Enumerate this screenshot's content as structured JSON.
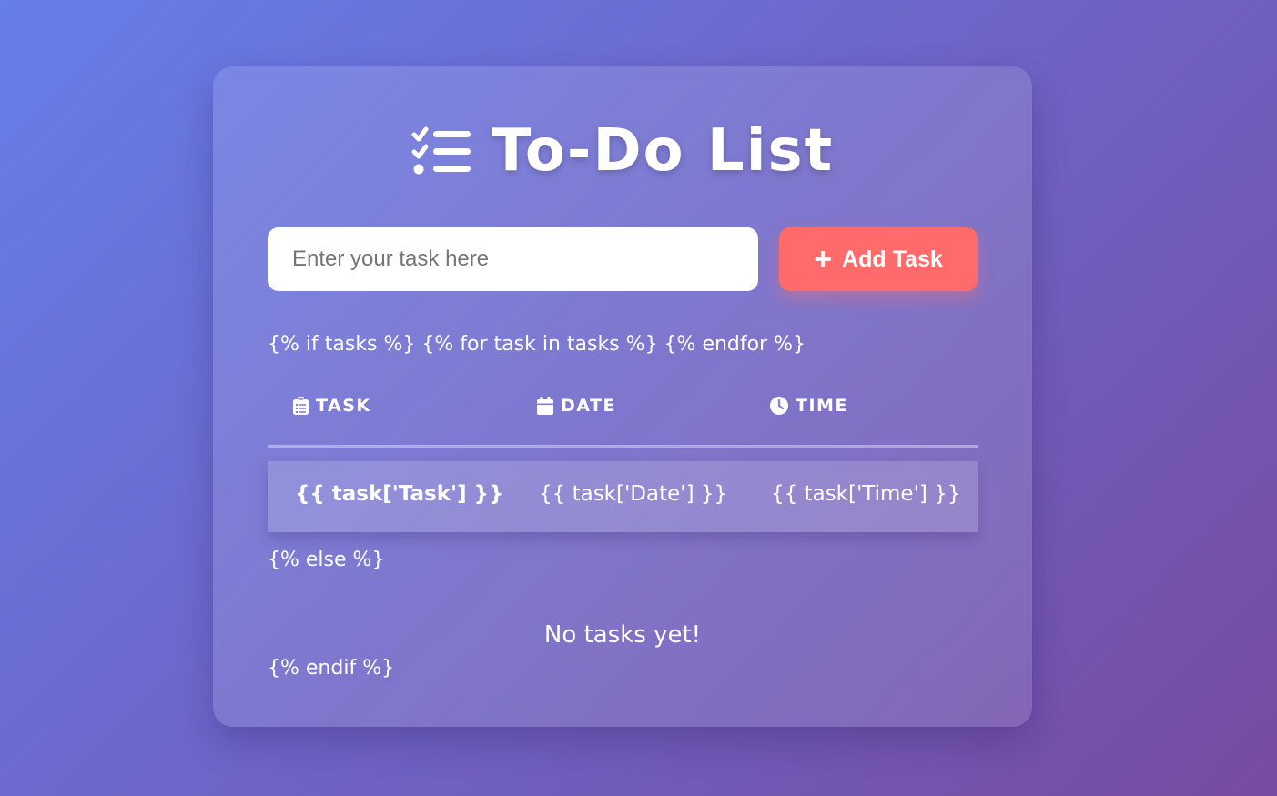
{
  "header": {
    "title": "To-Do List",
    "icon": "tasks-checklist-icon"
  },
  "form": {
    "input_placeholder": "Enter your task here",
    "input_value": "",
    "add_label": "Add Task",
    "add_icon": "plus-icon"
  },
  "template": {
    "if_line": "{% if tasks %} {% for task in tasks %} {% endfor %}",
    "else_line": "{% else %}",
    "endif_line": "{% endif %}"
  },
  "table": {
    "columns": [
      {
        "label": "TASK",
        "icon": "clipboard-list-icon"
      },
      {
        "label": "DATE",
        "icon": "calendar-icon"
      },
      {
        "label": "TIME",
        "icon": "clock-icon"
      }
    ],
    "rows": [
      {
        "task": "{{ task['Task'] }}",
        "date": "{{ task['Date'] }}",
        "time": "{{ task['Time'] }}"
      }
    ]
  },
  "empty_message": "No tasks yet!",
  "colors": {
    "bg_start": "#667eea",
    "bg_end": "#764ba2",
    "accent": "#ff6b6b",
    "text": "#ffffff"
  }
}
